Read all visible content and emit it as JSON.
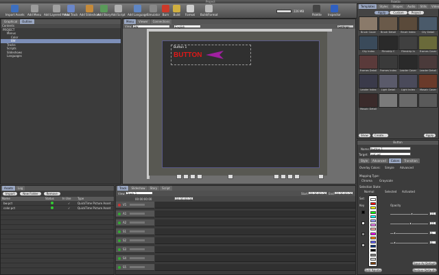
{
  "window": {
    "left_title": "Project",
    "right_title": "Palette"
  },
  "toolbar": {
    "buttons": [
      {
        "label": "Import Assets",
        "color": "#3d6fbf"
      },
      {
        "label": "Add Menu",
        "color": "#9c9c9c"
      },
      {
        "label": "Add Layered Menu",
        "color": "#a0a0a0"
      },
      {
        "label": "Add Track",
        "color": "#6a86c8"
      },
      {
        "label": "Add Slideshow",
        "color": "#c58a3a"
      },
      {
        "label": "Add Story",
        "color": "#5a9a5a"
      },
      {
        "label": "Add Script",
        "color": "#b0b0b0"
      },
      {
        "label": "Add Language",
        "color": "#5f86c4"
      },
      {
        "label": "Simulator",
        "color": "#888"
      },
      {
        "label": "Burn",
        "color": "#cc3a2a"
      },
      {
        "label": "Build",
        "color": "#d0b040"
      },
      {
        "label": "Format",
        "color": "#cfcfcf"
      },
      {
        "label": "Build/Format",
        "color": "#bdbdbd"
      },
      {
        "label": "Palette",
        "color": "#444"
      },
      {
        "label": "Inspector",
        "color": "#3060c0"
      }
    ],
    "disk_space": "226 MB"
  },
  "outline": {
    "tabs": [
      "Graphical",
      "Outline"
    ],
    "header": "Contents",
    "items": [
      {
        "label": "PROJECT",
        "indent": 0,
        "selected": false
      },
      {
        "label": "Menus",
        "indent": 1,
        "selected": false
      },
      {
        "label": "Color",
        "indent": 2,
        "selected": false
      },
      {
        "label": "BW",
        "indent": 2,
        "selected": true
      },
      {
        "label": "Tracks",
        "indent": 1,
        "selected": false
      },
      {
        "label": "Scripts",
        "indent": 1,
        "selected": false
      },
      {
        "label": "Slideshows",
        "indent": 1,
        "selected": false
      },
      {
        "label": "Languages",
        "indent": 1,
        "selected": false
      }
    ]
  },
  "viewer": {
    "tabs": [
      "Menu",
      "Viewer",
      "Connections"
    ],
    "view_label": "View:",
    "view_value": "BW",
    "language": "English",
    "settings": "Settings",
    "button_label": "Button 1",
    "button_text": "BUTTON"
  },
  "assets": {
    "tabs": [
      "Assets",
      "Log"
    ],
    "buttons": [
      "Import",
      "New Folder",
      "Remove"
    ],
    "columns": [
      "Name",
      "Status",
      "In Use",
      "Type"
    ],
    "rows": [
      {
        "name": "bw.pct",
        "in_use": "✓",
        "type": "QuickTime Picture Asset"
      },
      {
        "name": "color.pct",
        "in_use": "✓",
        "type": "QuickTime Picture Asset"
      }
    ]
  },
  "track": {
    "tabs": [
      "Track",
      "Slideshow",
      "Story",
      "Script"
    ],
    "view_label": "View:",
    "view_value": "Track 1",
    "timecode": "00:00:00:00",
    "start_label": "Start:",
    "start_value": "00:00:00:00",
    "end_label": "End:",
    "end_value": "00:00:00:00",
    "rows": [
      "V1",
      "A1",
      "A2",
      "S1",
      "S2",
      "S3",
      "S4",
      "S5"
    ]
  },
  "palette": {
    "tabs": [
      "Templates",
      "Styles",
      "Shapes",
      "Audio",
      "Stills",
      "Video"
    ],
    "sub_tabs": [
      "Apply",
      "Custom",
      "Project"
    ],
    "templates": [
      "Brush Cover",
      "Brush Detail",
      "Brush Index",
      "City Detail",
      "City Index",
      "Filmstrip C",
      "Filmstrip In",
      "Frames Cover",
      "Frames Detail",
      "Frames Index",
      "Leader Cover",
      "Leader Detail",
      "Leader Index",
      "Light Detail",
      "Light Index",
      "Mosaic Cover",
      "Mosaic Detail",
      "",
      "",
      ""
    ],
    "footer": [
      "Show",
      "Create..."
    ],
    "apply": "Apply"
  },
  "inspector": {
    "title": "Button",
    "name_label": "Name:",
    "name_value": "button 1",
    "target_label": "Target:",
    "target_value": "not set",
    "tabs": [
      "Style",
      "Advanced",
      "Colors",
      "Transition"
    ],
    "overlay_label": "Overlay Colors:",
    "overlay_options": [
      "Simple",
      "Advanced"
    ],
    "mapping_label": "Mapping Type:",
    "mapping_options": [
      "Chroma",
      "Grayscale"
    ],
    "selection_label": "Selection State:",
    "selection_options": [
      "Normal",
      "Selected",
      "Activated"
    ],
    "set_label": "Set:",
    "key_label": "Key",
    "opacity_label": "Opacity",
    "opacity_values": [
      "15",
      "15",
      "0",
      "0"
    ],
    "edit_palette": "Edit Palette",
    "save_default": "Save As Default",
    "restore_defaults": "Restore Defaults",
    "color_menu": [
      "#ffffff",
      "#ff0000",
      "#ffff00",
      "#00ff00",
      "#00ffff",
      "#a0a0ff",
      "#ff80ff",
      "#ffb0b0",
      "#ff00ff",
      "#ff8000",
      "#6060ff",
      "#003080",
      "#000000",
      "#808080",
      "#d0d0d0",
      "#804000"
    ]
  }
}
